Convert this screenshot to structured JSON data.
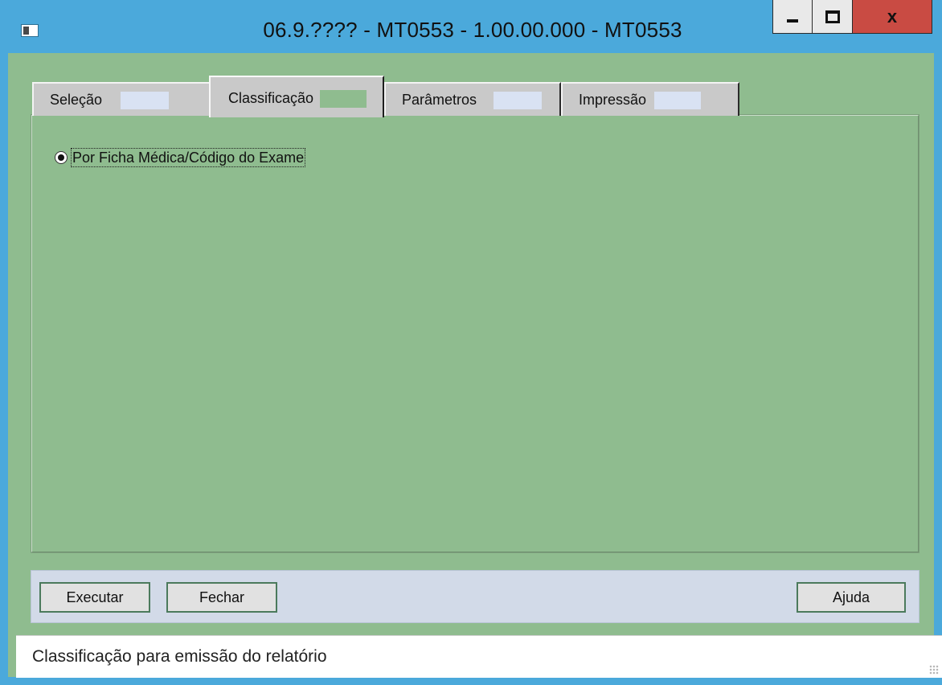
{
  "window": {
    "title": "06.9.???? - MT0553 - 1.00.00.000 - MT0553",
    "controls": {
      "minimize": "minimize",
      "maximize": "maximize",
      "close": "x"
    }
  },
  "tabs": [
    {
      "label": "Seleção",
      "active": false
    },
    {
      "label": "Classificação",
      "active": true
    },
    {
      "label": "Parâmetros",
      "active": false
    },
    {
      "label": "Impressão",
      "active": false
    }
  ],
  "classificacao": {
    "option_label": "Por Ficha Médica/Código do Exame",
    "selected": true
  },
  "buttons": {
    "execute": "Executar",
    "close": "Fechar",
    "help": "Ajuda"
  },
  "status": {
    "text": "Classificação para emissão do relatório"
  },
  "colors": {
    "frame": "#4ba9db",
    "client": "#8fbc8f",
    "button_bar": "#d2dae8",
    "close_button": "#c94b43"
  }
}
